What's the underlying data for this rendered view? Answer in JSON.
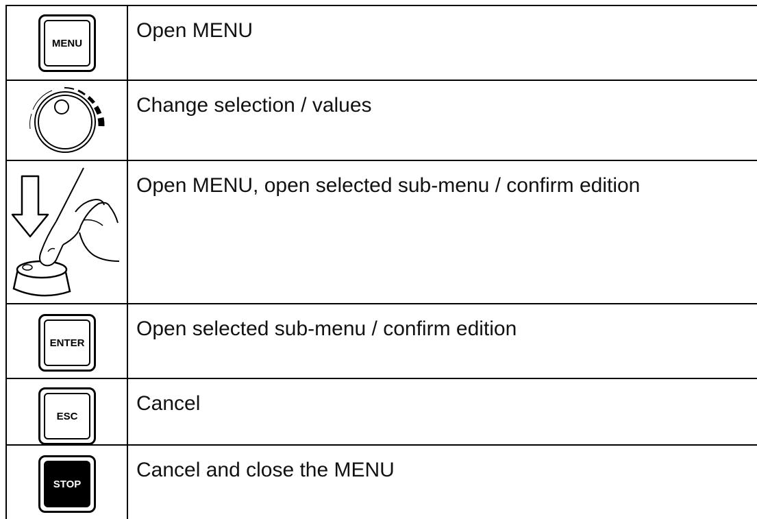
{
  "rows": [
    {
      "key_label": "MENU",
      "icon": "menu-key-icon",
      "description": "Open MENU"
    },
    {
      "key_label": "",
      "icon": "rotary-knob-icon",
      "description": "Change selection / values"
    },
    {
      "key_label": "",
      "icon": "press-knob-icon",
      "description": "Open MENU, open selected sub-menu / confirm edition"
    },
    {
      "key_label": "ENTER",
      "icon": "enter-key-icon",
      "description": "Open selected sub-menu / confirm edition"
    },
    {
      "key_label": "ESC",
      "icon": "esc-key-icon",
      "description": "Cancel"
    },
    {
      "key_label": "STOP",
      "icon": "stop-key-icon",
      "description": "Cancel and close the MENU"
    }
  ],
  "colors": {
    "line": "#000000",
    "background": "#ffffff",
    "stop_key_fill": "#000000"
  }
}
